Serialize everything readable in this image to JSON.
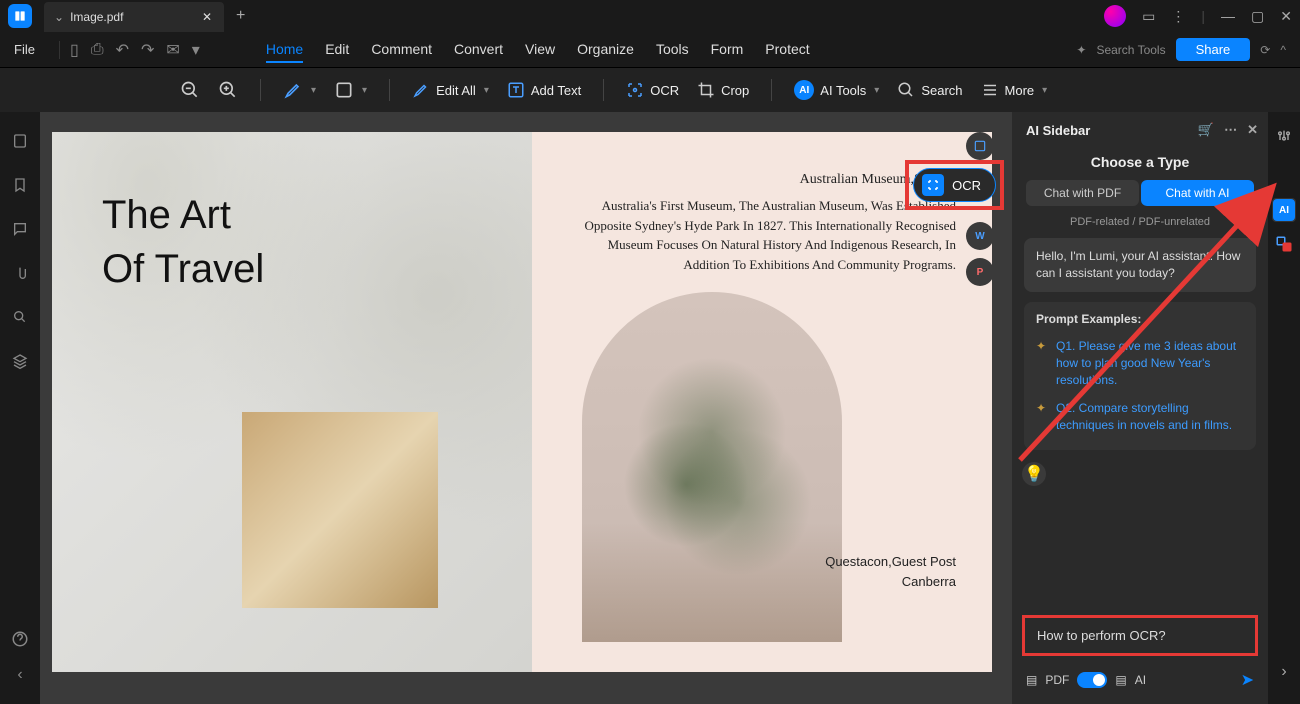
{
  "tab": {
    "title": "Image.pdf"
  },
  "file_menu": "File",
  "menus": {
    "home": "Home",
    "edit": "Edit",
    "comment": "Comment",
    "convert": "Convert",
    "view": "View",
    "organize": "Organize",
    "tools": "Tools",
    "form": "Form",
    "protect": "Protect"
  },
  "search_tools": "Search Tools",
  "share": "Share",
  "toolbar": {
    "edit_all": "Edit All",
    "add_text": "Add Text",
    "ocr": "OCR",
    "crop": "Crop",
    "ai_tools": "AI Tools",
    "search": "Search",
    "more": "More"
  },
  "doc": {
    "title_line1": "The Art",
    "title_line2": "Of Travel",
    "loc1": "Australian Museum,Sydney",
    "body": "Australia's First Museum, The Australian Museum, Was Established Opposite Sydney's Hyde Park In 1827. This Internationally Recognised Museum Focuses On Natural History And Indigenous Research, In Addition To Exhibitions And Community Programs.",
    "loc2_a": "Questacon,Guest Post",
    "loc2_b": "Canberra"
  },
  "ocr_pill": "OCR",
  "sidebar": {
    "title": "AI Sidebar",
    "choose": "Choose a Type",
    "tab_pdf": "Chat with PDF",
    "tab_ai": "Chat with AI",
    "rel": "PDF-related / PDF-unrelated",
    "greeting": "Hello, I'm Lumi, your AI assistant. How can I assistant you today?",
    "examples_title": "Prompt Examples:",
    "q1": "Q1. Please give me 3 ideas about how to plan good New Year's resolutions.",
    "q2": "Q2. Compare storytelling techniques in novels and in films.",
    "input": "How to perform OCR?",
    "foot_pdf": "PDF",
    "foot_ai": "AI"
  }
}
